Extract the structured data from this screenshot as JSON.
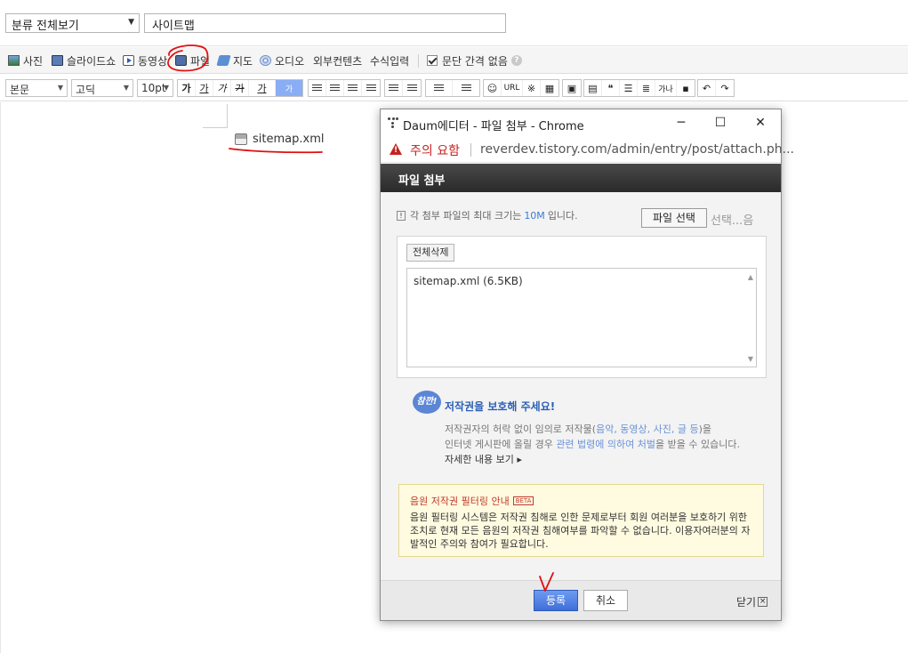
{
  "topbar": {
    "category": "분류 전체보기",
    "title_value": "사이트맵"
  },
  "insert_toolbar": {
    "photo": "사진",
    "slideshow": "슬라이드쇼",
    "video": "동영상",
    "file": "파일",
    "map": "지도",
    "audio": "오디오",
    "external": "외부컨텐츠",
    "formula": "수식입력",
    "no_spacing": "문단 간격 없음",
    "help": "?"
  },
  "format_toolbar": {
    "paragraph": "본문",
    "font": "고딕",
    "size": "10pt",
    "style_buttons": [
      "가",
      "가",
      "가",
      "가",
      "가",
      "가"
    ],
    "url": "URL",
    "symbol": "※",
    "quote": "❝",
    "text_size": "가나"
  },
  "editor": {
    "attached_file": "sitemap.xml"
  },
  "dialog": {
    "window_title": "Daum에디터 - 파일 첨부 - Chrome",
    "warning": "주의 요함",
    "url": "reverdev.tistory.com/admin/entry/post/attach.ph...",
    "header": "파일 첨부",
    "notice_prefix": "각 첨부 파일의 최대 크기는",
    "notice_size": "10M",
    "notice_suffix": "입니다.",
    "select_file": "파일 선택",
    "no_file": "선택...음",
    "delete_all": "전체삭제",
    "file_entry": "sitemap.xml (6.5KB)",
    "copy_badge": "참깐!",
    "copyright_title": "저작권을 보호해 주세요!",
    "desc1_a": "저작권자의 허락 없이 임의로 저작물(",
    "desc1_hl": "음악, 동영상, 사진, 글 등",
    "desc1_b": ")을",
    "desc2_a": "인터넷 게시판에 올릴 경우 ",
    "desc2_hl": "관련 법령에 의하여 처벌",
    "desc2_b": "을 받을 수 있습니다.",
    "more": "자세한 내용 보기 ▸",
    "filter_title": "음원 저작권 필터링 안내",
    "beta": "BETA",
    "filter_text": "음원 필터링 시스템은 저작권 침해로 인한 문제로부터 회원 여러분을 보호하기 위한 조치로 현재 모든 음원의 저작권 침해여부를 파악할 수 없습니다. 이용자여러분의 자발적인 주의와 참여가 필요합니다.",
    "ok": "등록",
    "cancel": "취소",
    "close": "닫기",
    "close_x": "×"
  },
  "colors": {
    "annotation": "#e01010",
    "primary_button": "#4a7de0",
    "warning": "#c5221f",
    "link": "#3a7bd5"
  }
}
